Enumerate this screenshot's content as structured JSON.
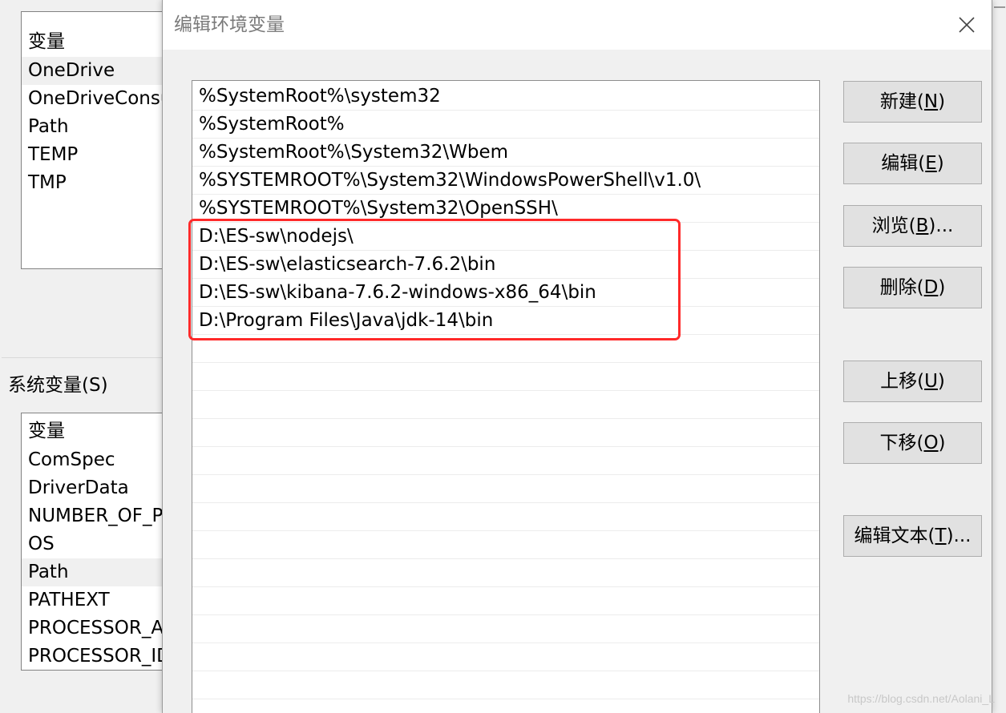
{
  "background_window": {
    "user_vars": {
      "header": "变量",
      "items": [
        "OneDrive",
        "OneDriveConsumer",
        "Path",
        "TEMP",
        "TMP"
      ]
    },
    "system_vars_label": "系统变量(S)",
    "system_vars": {
      "header": "变量",
      "items": [
        "ComSpec",
        "DriverData",
        "NUMBER_OF_PROCESSORS",
        "OS",
        "Path",
        "PATHEXT",
        "PROCESSOR_ARCHITECTURE",
        "PROCESSOR_IDENTIFIER"
      ]
    }
  },
  "dialog": {
    "title": "编辑环境变量",
    "close_icon": "close-icon",
    "paths": [
      "%SystemRoot%\\system32",
      "%SystemRoot%",
      "%SystemRoot%\\System32\\Wbem",
      "%SYSTEMROOT%\\System32\\WindowsPowerShell\\v1.0\\",
      "%SYSTEMROOT%\\System32\\OpenSSH\\",
      "D:\\ES-sw\\nodejs\\",
      "D:\\ES-sw\\elasticsearch-7.6.2\\bin",
      "D:\\ES-sw\\kibana-7.6.2-windows-x86_64\\bin",
      "D:\\Program Files\\Java\\jdk-14\\bin"
    ],
    "buttons": {
      "new": {
        "pre": "新建(",
        "key": "N",
        "post": ")"
      },
      "edit": {
        "pre": "编辑(",
        "key": "E",
        "post": ")"
      },
      "browse": {
        "pre": "浏览(",
        "key": "B",
        "post": ")..."
      },
      "delete": {
        "pre": "删除(",
        "key": "D",
        "post": ")"
      },
      "up": {
        "pre": "上移(",
        "key": "U",
        "post": ")"
      },
      "down": {
        "pre": "下移(",
        "key": "O",
        "post": ")"
      },
      "edit_text": {
        "pre": "编辑文本(",
        "key": "T",
        "post": ")..."
      }
    },
    "highlight_color": "#ff2a2a"
  },
  "watermark": "https://blog.csdn.net/Aolani_L"
}
